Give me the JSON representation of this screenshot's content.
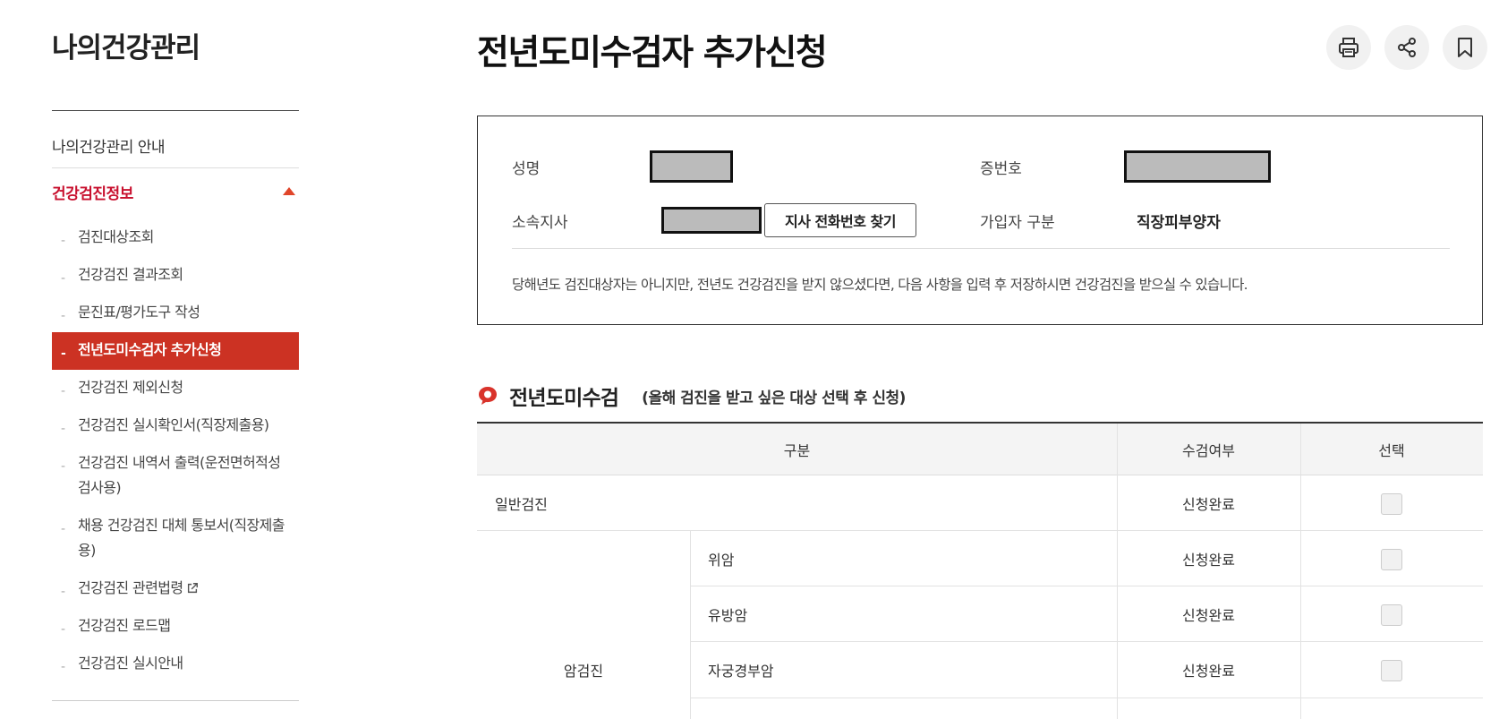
{
  "sidebar": {
    "title": "나의건강관리",
    "intro": "나의건강관리 안내",
    "section": "건강검진정보",
    "items": [
      {
        "label": "검진대상조회"
      },
      {
        "label": "건강검진 결과조회"
      },
      {
        "label": "문진표/평가도구 작성"
      },
      {
        "label": "전년도미수검자 추가신청"
      },
      {
        "label": "건강검진 제외신청"
      },
      {
        "label": "건강검진 실시확인서(직장제출용)"
      },
      {
        "label": "건강검진 내역서 출력(운전면허적성검사용)"
      },
      {
        "label": "채용 건강검진 대체 통보서(직장제출용)"
      },
      {
        "label": "건강검진 관련법령"
      },
      {
        "label": "건강검진 로드맵"
      },
      {
        "label": "건강검진 실시안내"
      }
    ]
  },
  "header": {
    "title": "전년도미수검자 추가신청",
    "icons": [
      "print-icon",
      "share-icon",
      "bookmark-icon"
    ]
  },
  "info": {
    "name_label": "성명",
    "id_label": "증번호",
    "branch_label": "소속지사",
    "find_button": "지사 전화번호 찾기",
    "type_label": "가입자 구분",
    "type_value": "직장피부양자",
    "notice": "당해년도 검진대상자는 아니지만, 전년도 건강검진을 받지 않으셨다면, 다음 사항을 입력 후 저장하시면 건강검진을 받으실 수 있습니다."
  },
  "section": {
    "title": "전년도미수검",
    "subtitle": "(올해 검진을 받고 싶은 대상 선택 후 신청)"
  },
  "table": {
    "headers": [
      "구분",
      "수검여부",
      "선택"
    ],
    "rows": [
      {
        "category": "일반검진",
        "item": "",
        "status": "신청완료"
      },
      {
        "category": "암검진",
        "item": "위암",
        "status": "신청완료"
      },
      {
        "category": "암검진",
        "item": "유방암",
        "status": "신청완료"
      },
      {
        "category": "암검진",
        "item": "자궁경부암",
        "status": "신청완료"
      }
    ],
    "cancer_label": "암검진"
  },
  "colors": {
    "accent": "#cc3223",
    "section_red": "#c8102e"
  }
}
